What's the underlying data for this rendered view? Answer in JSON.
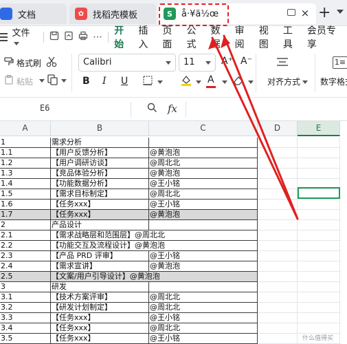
{
  "tabs": [
    {
      "label": "文档",
      "icon": "doc-icon"
    },
    {
      "label": "找稻壳模板",
      "icon": "template-icon"
    },
    {
      "label": "å·¥ä½œ",
      "icon": "sheet-icon"
    }
  ],
  "tab_icons": {
    "doc": "",
    "template": "✿",
    "sheet": "S"
  },
  "menu": {
    "file_label": "文件",
    "tabs": [
      "开始",
      "插入",
      "页面",
      "公式",
      "数据",
      "审阅",
      "视图",
      "工具",
      "会员专享"
    ],
    "active": "开始"
  },
  "ribbon": {
    "format_painter": "格式刷",
    "paste": "粘贴",
    "font_name": "Calibri",
    "font_size": "11",
    "font_grow": "A⁺",
    "font_shrink": "A⁻",
    "bold": "B",
    "italic": "I",
    "underline": "U",
    "font_color_glyph": "A",
    "align_label": "对齐方式",
    "number_format_label": "数字格式"
  },
  "formula_bar": {
    "name_box": "E6",
    "fx": "fx"
  },
  "columns": [
    "A",
    "B",
    "C",
    "D",
    "E"
  ],
  "rows": [
    {
      "a": "1",
      "b": "需求分析",
      "c": ""
    },
    {
      "a": "1.1",
      "b": "【用户反馈分析】",
      "c": "@黄泡泡"
    },
    {
      "a": "1.2",
      "b": "【用户调研访谈】",
      "c": "@周北北"
    },
    {
      "a": "1.3",
      "b": "【竞品体验分析】",
      "c": "@黄泡泡"
    },
    {
      "a": "1.4",
      "b": "【功能数据分析】",
      "c": "@王小铭"
    },
    {
      "a": "1.5",
      "b": "【需求目标制定】",
      "c": "@周北北"
    },
    {
      "a": "1.6",
      "b": "【任务xxx】",
      "c": "@王小铭"
    },
    {
      "a": "1.7",
      "b": "【任务xxx】",
      "c": "@黄泡泡",
      "gray": true
    },
    {
      "a": "2",
      "b": "产品设计",
      "c": ""
    },
    {
      "a": "2.1",
      "b": "【需求战略层和范围层】@周北北",
      "c": "",
      "merge": true
    },
    {
      "a": "2.2",
      "b": "【功能交互及流程设计】@黄泡泡",
      "c": "",
      "merge": true
    },
    {
      "a": "2.3",
      "b": "【产品 PRD 评审】",
      "c": "@王小铭"
    },
    {
      "a": "2.4",
      "b": "【需求宣讲】",
      "c": "@黄泡泡"
    },
    {
      "a": "2.5",
      "b": "【文案/用户引导设计】@黄泡泡",
      "c": "",
      "gray": true,
      "merge": true
    },
    {
      "a": "3",
      "b": "研发",
      "c": ""
    },
    {
      "a": "3.1",
      "b": "【技术方案评审】",
      "c": "@周北北"
    },
    {
      "a": "3.2",
      "b": "【研发计划制定】",
      "c": "@周北北"
    },
    {
      "a": "3.3",
      "b": "【任务xxx】",
      "c": "@王小铭"
    },
    {
      "a": "3.4",
      "b": "【任务xxx】",
      "c": "@周北北"
    },
    {
      "a": "3.5",
      "b": "【任务xxx】",
      "c": "@王小铭"
    }
  ],
  "watermark": "什么值得买",
  "colors": {
    "accent": "#1f7a4f",
    "annotation": "#e02020"
  }
}
